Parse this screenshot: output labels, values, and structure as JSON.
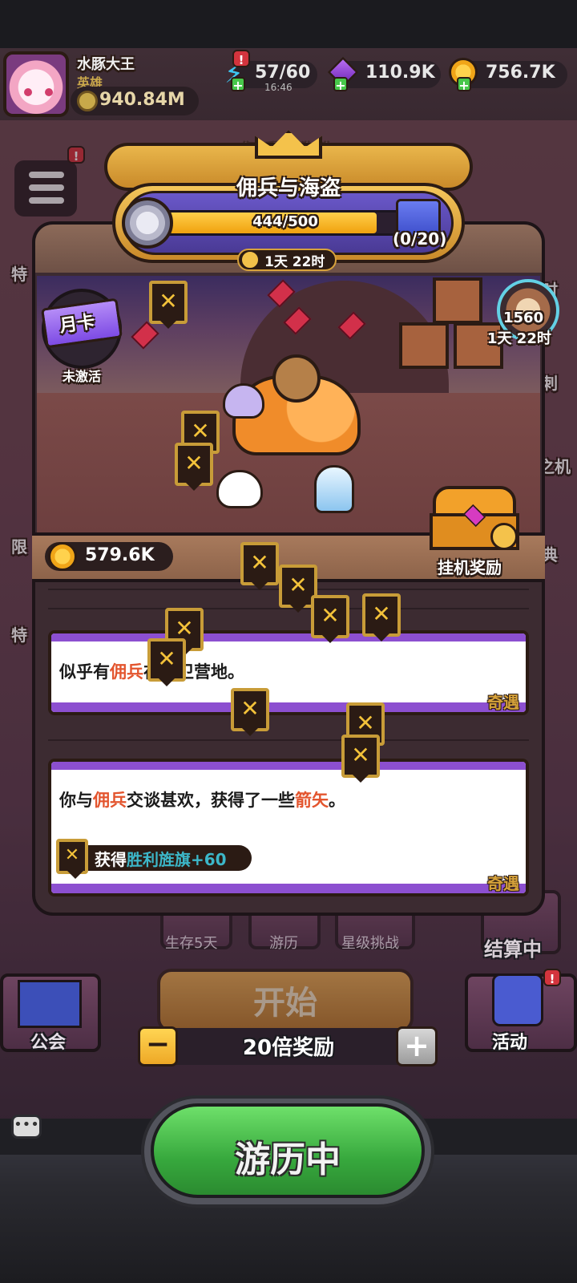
{
  "header": {
    "player_name": "水豚大王",
    "player_title": "英雄",
    "power": "940.84M",
    "energy": "57/60",
    "energy_timer": "16:46",
    "gems": "110.9K",
    "gold": "756.7K"
  },
  "banner": {
    "title": "佣兵与海盗",
    "title_ghost": "佣兵与海盗",
    "progress_text": "444/500",
    "progress_fraction": 0.888,
    "gift_count": "(0/20)",
    "timer": "1天 22时"
  },
  "scene": {
    "month_card": "月卡",
    "month_card_status": "未激活",
    "right_value": "1560",
    "right_timer": "1天 22时",
    "coins": "579.6K",
    "idle_reward": "挂机奖励"
  },
  "events": [
    {
      "text_pre": "似乎有",
      "text_hl": "佣兵",
      "text_post": "在守卫营地。",
      "tag": "奇遇"
    },
    {
      "text_pre": "你与",
      "text_hl": "佣兵",
      "text_mid": "交谈甚欢，获得了一些",
      "text_hl2": "箭矢",
      "text_post": "。",
      "reward_label": "获得",
      "reward_item": "胜利旌旗+60",
      "tag": "奇遇"
    }
  ],
  "nav": {
    "survive": "生存5天",
    "travel": "游历",
    "star_challenge": "星级挑战",
    "settling": "结算中",
    "guild": "公会",
    "activity": "活动",
    "start": "开始",
    "multiplier": "20倍奖励",
    "minus": "−",
    "plus": "+",
    "travel_status": "游历中"
  },
  "side_labels": [
    "特",
    "限",
    "特",
    "时",
    "刺",
    "之机",
    "典"
  ],
  "colors": {
    "accent_gold": "#f0a518",
    "event_purple": "#8c4fd0",
    "highlight_orange": "#e3552e",
    "highlight_cyan": "#3cb7c9",
    "travel_green": "#37a83d"
  }
}
